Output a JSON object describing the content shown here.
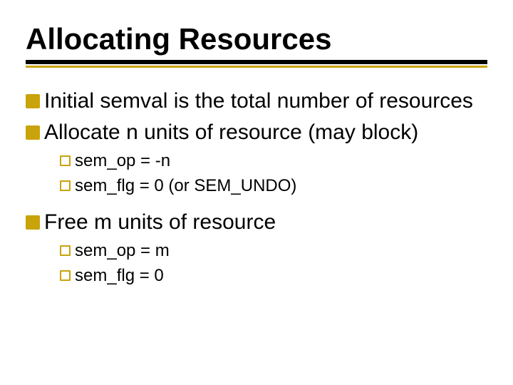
{
  "title": "Allocating Resources",
  "bullets": {
    "b1": "Initial semval is the total number of resources",
    "b2": "Allocate  n units of resource (may block)",
    "b2_sub": {
      "s1": "sem_op = -n",
      "s2": "sem_flg = 0 (or SEM_UNDO)"
    },
    "b3": "Free m units of resource",
    "b3_sub": {
      "s1": "sem_op = m",
      "s2": "sem_flg = 0"
    }
  }
}
